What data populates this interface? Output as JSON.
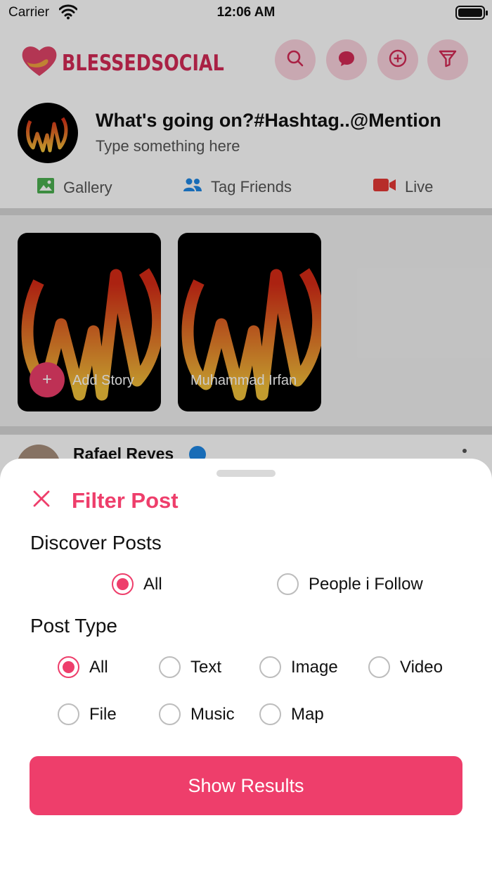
{
  "status_bar": {
    "carrier": "Carrier",
    "time": "12:06 AM",
    "wifi_icon": "wifi-icon",
    "battery_icon": "battery-icon"
  },
  "header": {
    "logo_text": "BLESSEDSOCIAL",
    "brand_color": "#d42a55",
    "actions": [
      {
        "name": "search",
        "icon": "search-icon"
      },
      {
        "name": "messages",
        "icon": "chat-bubble-icon"
      },
      {
        "name": "create",
        "icon": "plus-circle-icon"
      },
      {
        "name": "filter",
        "icon": "filter-icon"
      }
    ]
  },
  "composer": {
    "title": "What's going on?#Hashtag..@Mention",
    "placeholder": "Type something here",
    "actions": [
      {
        "label": "Gallery",
        "icon": "gallery-icon"
      },
      {
        "label": "Tag Friends",
        "icon": "people-icon"
      },
      {
        "label": "Live",
        "icon": "video-camera-icon"
      }
    ]
  },
  "stories": [
    {
      "label": "Add Story",
      "icon": "plus-icon"
    },
    {
      "label": "Muhammad Irfan"
    }
  ],
  "post": {
    "author": "Rafael Reyes",
    "verified_icon": "verified-badge-icon"
  },
  "filter_sheet": {
    "title": "Filter Post",
    "accent": "#ee3e6b",
    "discover": {
      "heading": "Discover Posts",
      "options": [
        {
          "label": "All",
          "selected": true
        },
        {
          "label": "People i Follow",
          "selected": false
        }
      ]
    },
    "post_type": {
      "heading": "Post Type",
      "options": [
        {
          "label": "All",
          "selected": true
        },
        {
          "label": "Text",
          "selected": false
        },
        {
          "label": "Image",
          "selected": false
        },
        {
          "label": "Video",
          "selected": false
        },
        {
          "label": "File",
          "selected": false
        },
        {
          "label": "Music",
          "selected": false
        },
        {
          "label": "Map",
          "selected": false
        }
      ]
    },
    "submit_label": "Show Results"
  }
}
